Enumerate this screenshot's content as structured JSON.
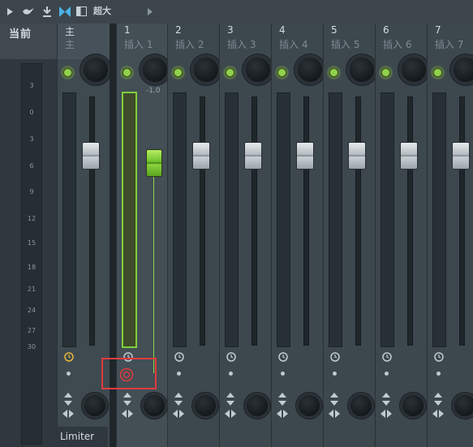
{
  "toolbar": {
    "size_label": "超大"
  },
  "sidebar": {
    "current_label": "当前",
    "ticks": [
      "3",
      "0",
      "3",
      "6",
      "9",
      "12",
      "15",
      "18",
      "21",
      "24",
      "27",
      "30"
    ]
  },
  "strips": {
    "master": {
      "num": "主",
      "name": "主",
      "plugin": "Limiter"
    },
    "insert1": {
      "num": "1",
      "name": "插入 1",
      "volume": "-1.0"
    },
    "insert2": {
      "num": "2",
      "name": "插入 2"
    },
    "insert3": {
      "num": "3",
      "name": "插入 3"
    },
    "insert4": {
      "num": "4",
      "name": "插入 4"
    },
    "insert5": {
      "num": "5",
      "name": "插入 5"
    },
    "insert6": {
      "num": "6",
      "name": "插入 6"
    },
    "insert7": {
      "num": "7",
      "name": "插入 7"
    }
  },
  "colors": {
    "accent_green": "#8fd24b",
    "highlight_red": "#e03c3c",
    "background": "#3b454c"
  },
  "icons": {
    "toolbar": [
      "play-arrow-icon",
      "bird-icon",
      "insert-icon",
      "bowtie-icon",
      "window-icon",
      "arrow-right-icon"
    ],
    "strip": [
      "led-icon",
      "clock-icon",
      "dot-icon",
      "updown-arrows-icon",
      "leftright-arrows-icon",
      "record-icon"
    ]
  }
}
